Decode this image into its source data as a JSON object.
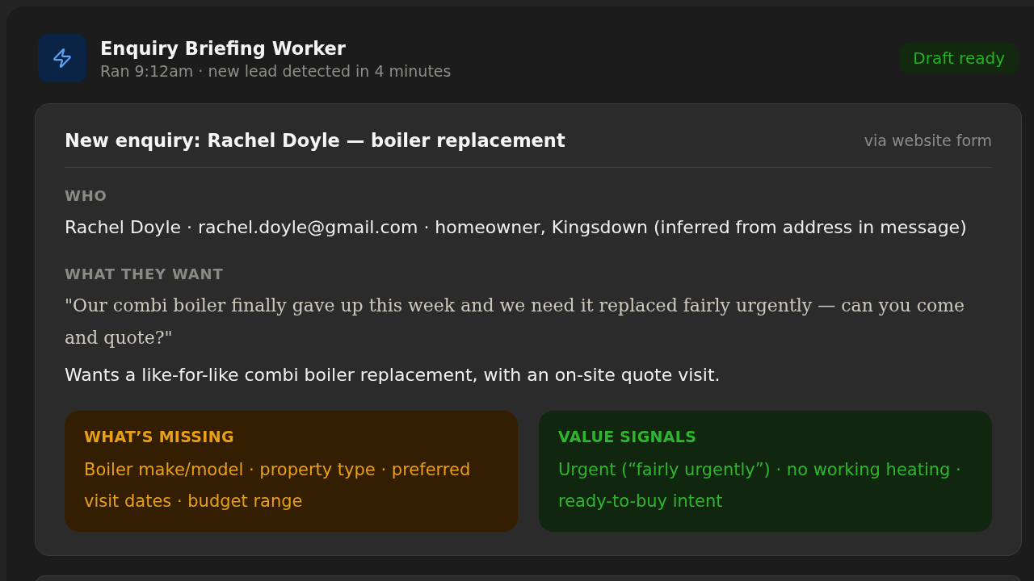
{
  "worker": {
    "title": "Enquiry Briefing Worker",
    "subtitle": "Ran 9:12am · new lead detected in 4 minutes",
    "status": {
      "label": "Draft ready",
      "kind": "ready"
    }
  },
  "enquiry": {
    "title": "New enquiry: Rachel Doyle — boiler replacement",
    "source": "via website form",
    "sections": [
      {
        "kind": "text",
        "heading": "WHO",
        "text": "Rachel Doyle · rachel.doyle@gmail.com · homeowner, Kingsdown (inferred from address in message)"
      },
      {
        "kind": "quote",
        "heading": "WHAT THEY WANT",
        "quote": "\"Our combi boiler finally gave up this week and we need it replaced fairly urgently — can you come and quote?\"",
        "summary": "Wants a like-for-like combi boiler replacement, with an on-site quote visit."
      }
    ],
    "callouts": [
      {
        "kind": "warning",
        "heading": "WHAT’S MISSING",
        "text": "Boiler make/model · property type · preferred visit dates · budget range"
      },
      {
        "kind": "success",
        "heading": "VALUE SIGNALS",
        "text": "Urgent (“fairly urgently”) · no working heating · ready-to-buy intent"
      }
    ]
  }
}
